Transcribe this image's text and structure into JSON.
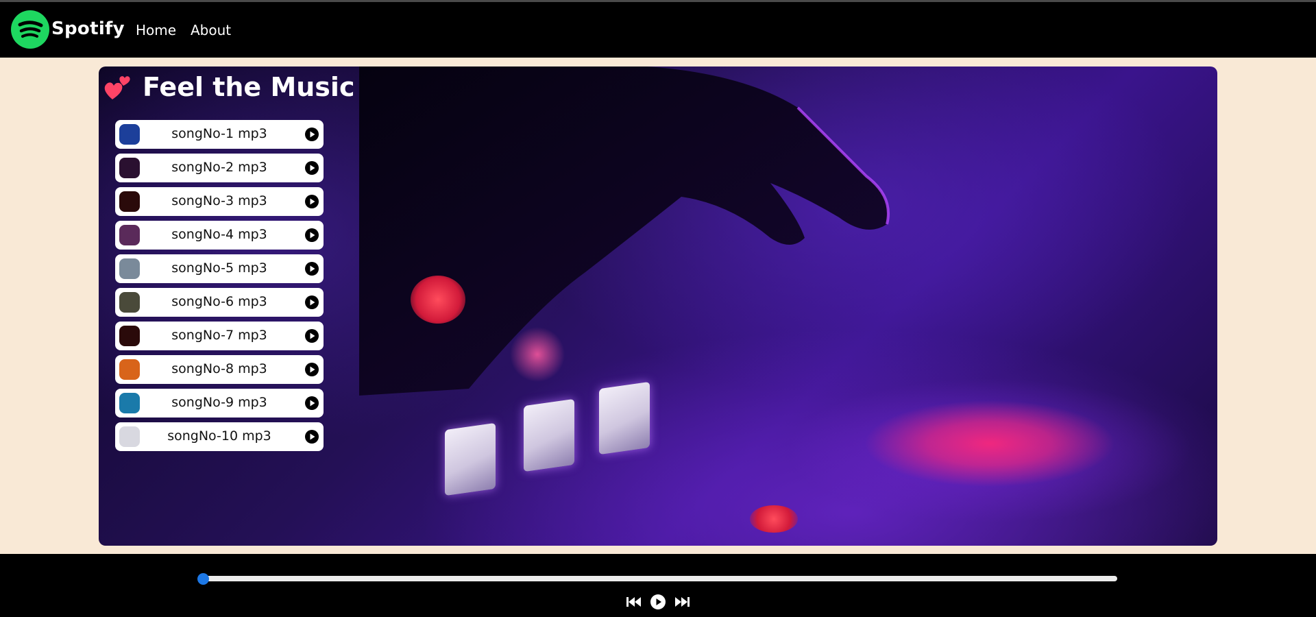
{
  "nav": {
    "brand": "Spotify",
    "links": [
      {
        "label": "Home"
      },
      {
        "label": "About"
      }
    ]
  },
  "main": {
    "title": "Feel the Music",
    "songs": [
      {
        "name": "songNo-1 mp3",
        "cover_color": "#1c3f9a"
      },
      {
        "name": "songNo-2 mp3",
        "cover_color": "#2a1030"
      },
      {
        "name": "songNo-3 mp3",
        "cover_color": "#2a0a0a"
      },
      {
        "name": "songNo-4 mp3",
        "cover_color": "#5a2a5a"
      },
      {
        "name": "songNo-5 mp3",
        "cover_color": "#7a8a9a"
      },
      {
        "name": "songNo-6 mp3",
        "cover_color": "#4a4a3a"
      },
      {
        "name": "songNo-7 mp3",
        "cover_color": "#2a0a0a"
      },
      {
        "name": "songNo-8 mp3",
        "cover_color": "#d8641a"
      },
      {
        "name": "songNo-9 mp3",
        "cover_color": "#1a7aaa"
      },
      {
        "name": "songNo-10 mp3",
        "cover_color": "#d8d8e0"
      }
    ]
  },
  "player": {
    "progress": 0
  },
  "colors": {
    "accent": "#1ed760",
    "slider": "#1d78e6",
    "page_bg": "#f9e9d6"
  }
}
